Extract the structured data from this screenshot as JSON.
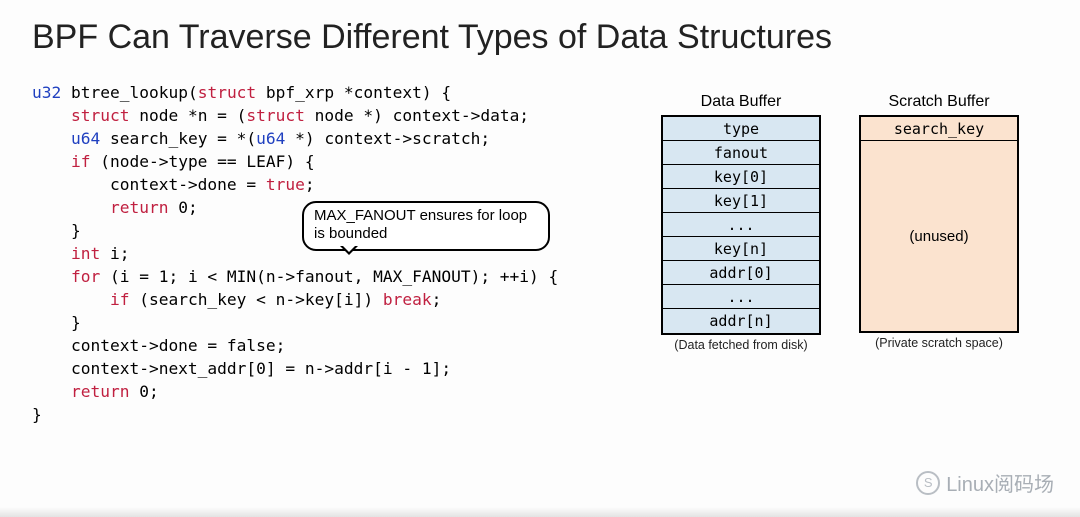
{
  "title": "BPF Can Traverse Different Types of Data Structures",
  "code": {
    "l1_a": "u32",
    "l1_b": " btree_lookup(",
    "l1_c": "struct",
    "l1_d": " bpf_xrp *context) {",
    "l2_a": "struct",
    "l2_b": " node *n = (",
    "l2_c": "struct",
    "l2_d": " node *) context->data;",
    "l3_a": "u64",
    "l3_b": " search_key = *(",
    "l3_c": "u64",
    "l3_d": " *) context->scratch;",
    "l4_a": "if",
    "l4_b": " (node->type == LEAF) {",
    "l5_a": "context->done = ",
    "l5_b": "true",
    "l5_c": ";",
    "l6_a": "return",
    "l6_b": " 0;",
    "l7": "}",
    "l8_a": "int",
    "l8_b": " i;",
    "l9_a": "for",
    "l9_b": " (i = 1; i < MIN(n->fanout, MAX_FANOUT); ++i) {",
    "l10_a": "if",
    "l10_b": " (search_key < n->key[i]) ",
    "l10_c": "break",
    "l10_d": ";",
    "l11": "}",
    "l12": "context->done = false;",
    "l13": "context->next_addr[0] = n->addr[i - 1];",
    "l14_a": "return",
    "l14_b": " 0;",
    "l15": "}"
  },
  "callout": "MAX_FANOUT ensures for loop is bounded",
  "buffers": {
    "data": {
      "label": "Data Buffer",
      "cells": [
        "type",
        "fanout",
        "key[0]",
        "key[1]",
        "...",
        "key[n]",
        "addr[0]",
        "...",
        "addr[n]"
      ],
      "caption": "(Data fetched from disk)"
    },
    "scratch": {
      "label": "Scratch Buffer",
      "top": "search_key",
      "body": "(unused)",
      "caption": "(Private scratch space)"
    }
  },
  "watermark": {
    "icon": "S",
    "text": "Linux阅码场"
  }
}
